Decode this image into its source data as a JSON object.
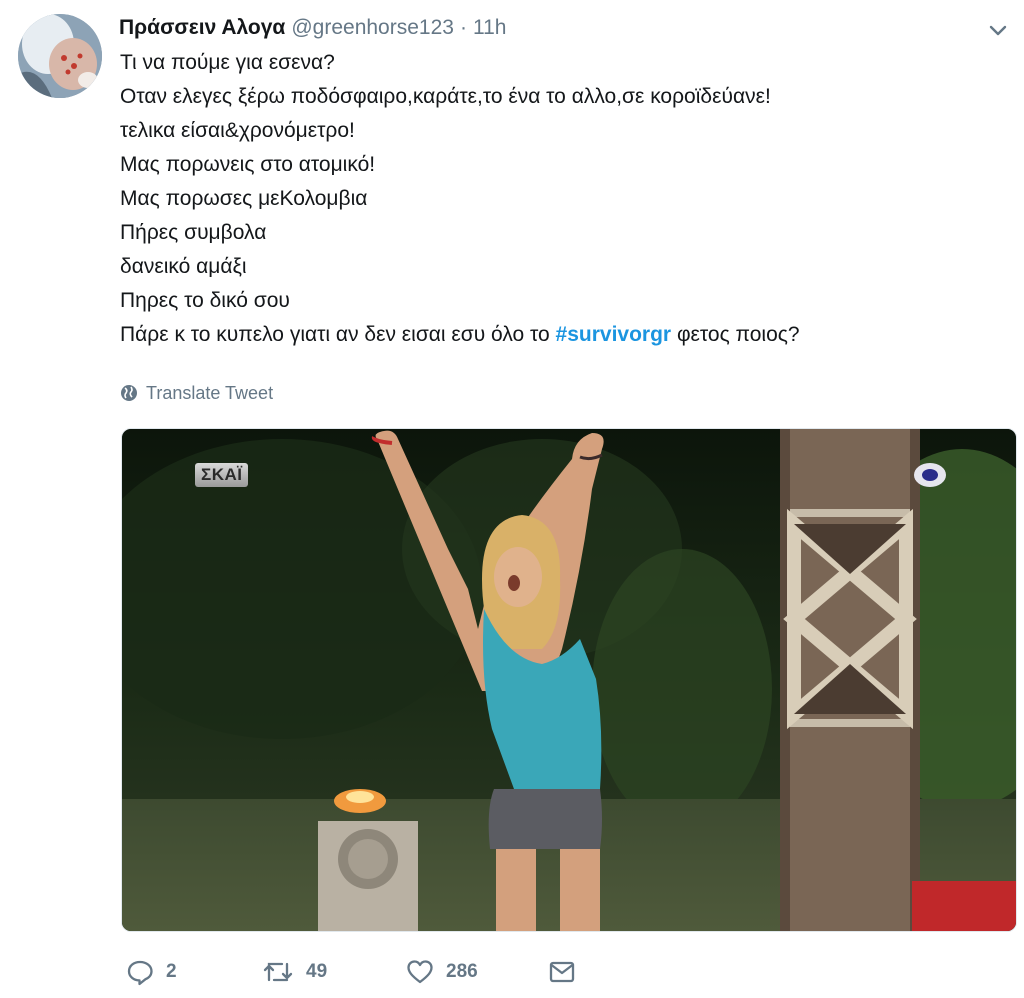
{
  "tweet": {
    "display_name": "Πράσσειν Αλογα",
    "handle": "@greenhorse123",
    "separator": "·",
    "time": "11h",
    "lines": [
      "Τι να πούμε για εσενα?",
      "Οταν ελεγες ξέρω ποδόσφαιρο,καράτε,το ένα το αλλο,σε κοροϊδεύανε!",
      "τελικα είσαι&χρονόμετρο!",
      "Μας πορωνεις στο ατομικό!",
      "Μας πορωσες μεΚολομβια",
      "Πήρες συμβολα",
      "δανεικό αμάξι",
      "Πηρες το δικό σου"
    ],
    "last_line_before": "Πάρε κ το κυπελο γιατι αν δεν εισαι εσυ όλο το ",
    "hashtag": "#survivorgr",
    "last_line_after": " φετος ποιος?",
    "translate_label": "Translate Tweet",
    "media": {
      "channel_logo": "ΣΚΑΪ"
    },
    "actions": {
      "replies": "2",
      "retweets": "49",
      "likes": "286"
    }
  },
  "icons": {
    "caret": "chevron-down-icon",
    "globe": "globe-icon",
    "reply": "reply-icon",
    "retweet": "retweet-icon",
    "like": "heart-icon",
    "dm": "envelope-icon"
  },
  "colors": {
    "hashtag": "#1b95e0",
    "secondary_text": "#657786",
    "primary_text": "#14171a"
  }
}
